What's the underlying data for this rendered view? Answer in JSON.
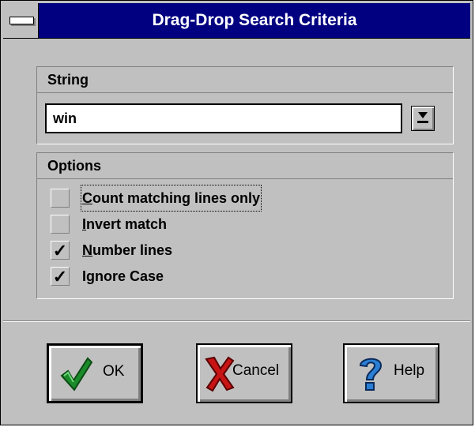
{
  "window": {
    "title": "Drag-Drop Search Criteria"
  },
  "string_group": {
    "header": "String",
    "value": "win"
  },
  "options_group": {
    "header": "Options",
    "items": [
      {
        "pre": "",
        "key": "C",
        "post": "ount matching lines only",
        "checked": false,
        "mark": ""
      },
      {
        "pre": "",
        "key": "I",
        "post": "nvert match",
        "checked": false,
        "mark": ""
      },
      {
        "pre": "",
        "key": "N",
        "post": "umber lines",
        "checked": true,
        "mark": "✓"
      },
      {
        "pre": "I",
        "key": "g",
        "post": "nore Case",
        "checked": true,
        "mark": "✓"
      }
    ]
  },
  "buttons": {
    "ok": "OK",
    "cancel": "Cancel",
    "help": "Help"
  },
  "icons": {
    "ok": "checkmark-icon",
    "cancel": "red-x-icon",
    "help": "question-mark-icon"
  },
  "colors": {
    "titlebar": "#000080",
    "face": "#c0c0c0",
    "ok_icon": "#1a8a2a",
    "cancel_icon": "#c81414",
    "help_icon": "#2a7fd4"
  }
}
